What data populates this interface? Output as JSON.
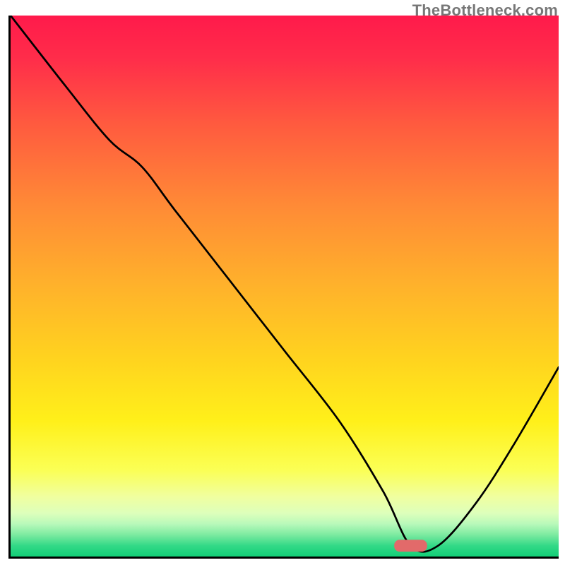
{
  "attribution": "TheBottleneck.com",
  "chart_data": {
    "type": "line",
    "title": "",
    "xlabel": "",
    "ylabel": "",
    "xlim": [
      0,
      100
    ],
    "ylim": [
      0,
      100
    ],
    "description": "Bottleneck curve over a red-to-green vertical heat gradient. The black curve drops from upper-left, reaches a flat minimum near x≈73, then rises toward the right edge. A small red rounded marker sits at the trough.",
    "grid": false,
    "legend": false,
    "series": [
      {
        "name": "bottleneck",
        "x": [
          0,
          10,
          18,
          24,
          30,
          40,
          50,
          60,
          68,
          73,
          78,
          85,
          92,
          100
        ],
        "y": [
          100,
          87,
          77,
          72,
          64,
          51,
          38,
          25,
          12,
          2,
          2,
          10,
          21,
          35
        ]
      }
    ],
    "marker": {
      "x": 73,
      "y": 2,
      "w": 6,
      "h": 2.2,
      "color": "#e26a6a"
    },
    "gradient_stops": [
      {
        "pos": 0.0,
        "color": "#ff1a4b"
      },
      {
        "pos": 0.08,
        "color": "#ff2d4a"
      },
      {
        "pos": 0.2,
        "color": "#ff5a3f"
      },
      {
        "pos": 0.35,
        "color": "#ff8a36"
      },
      {
        "pos": 0.5,
        "color": "#ffb22b"
      },
      {
        "pos": 0.63,
        "color": "#ffd21f"
      },
      {
        "pos": 0.75,
        "color": "#fff01a"
      },
      {
        "pos": 0.84,
        "color": "#fbff55"
      },
      {
        "pos": 0.89,
        "color": "#f0ffa0"
      },
      {
        "pos": 0.92,
        "color": "#ddffbb"
      },
      {
        "pos": 0.94,
        "color": "#b8f9ba"
      },
      {
        "pos": 0.96,
        "color": "#7ceaa0"
      },
      {
        "pos": 0.98,
        "color": "#33d987"
      },
      {
        "pos": 1.0,
        "color": "#12cf77"
      }
    ]
  }
}
